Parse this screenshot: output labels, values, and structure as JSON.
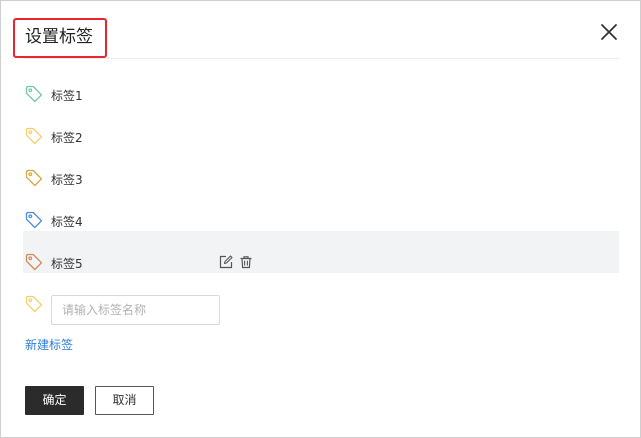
{
  "dialog": {
    "title": "设置标签",
    "close_icon": "close-icon"
  },
  "tags": [
    {
      "label": "标签1",
      "color": "#74c7a8",
      "icon": "tag-icon"
    },
    {
      "label": "标签2",
      "color": "#f3cf6e",
      "icon": "tag-icon"
    },
    {
      "label": "标签3",
      "color": "#d9a63a",
      "icon": "tag-icon"
    },
    {
      "label": "标签4",
      "color": "#4a8de0",
      "icon": "tag-icon"
    },
    {
      "label": "标签5",
      "color": "#d2895c",
      "icon": "tag-icon",
      "hovered": true
    }
  ],
  "row_actions": {
    "edit_icon": "edit-icon",
    "delete_icon": "trash-icon"
  },
  "new_tag": {
    "color": "#f3cf6e",
    "placeholder": "请输入标签名称",
    "value": "",
    "link_label": "新建标签"
  },
  "footer": {
    "ok_label": "确定",
    "cancel_label": "取消"
  },
  "colors": {
    "highlight_border": "#e8262d",
    "link": "#2f7fd8",
    "hover_row_bg": "#f2f3f5",
    "primary_button": "#2b2b2b"
  }
}
